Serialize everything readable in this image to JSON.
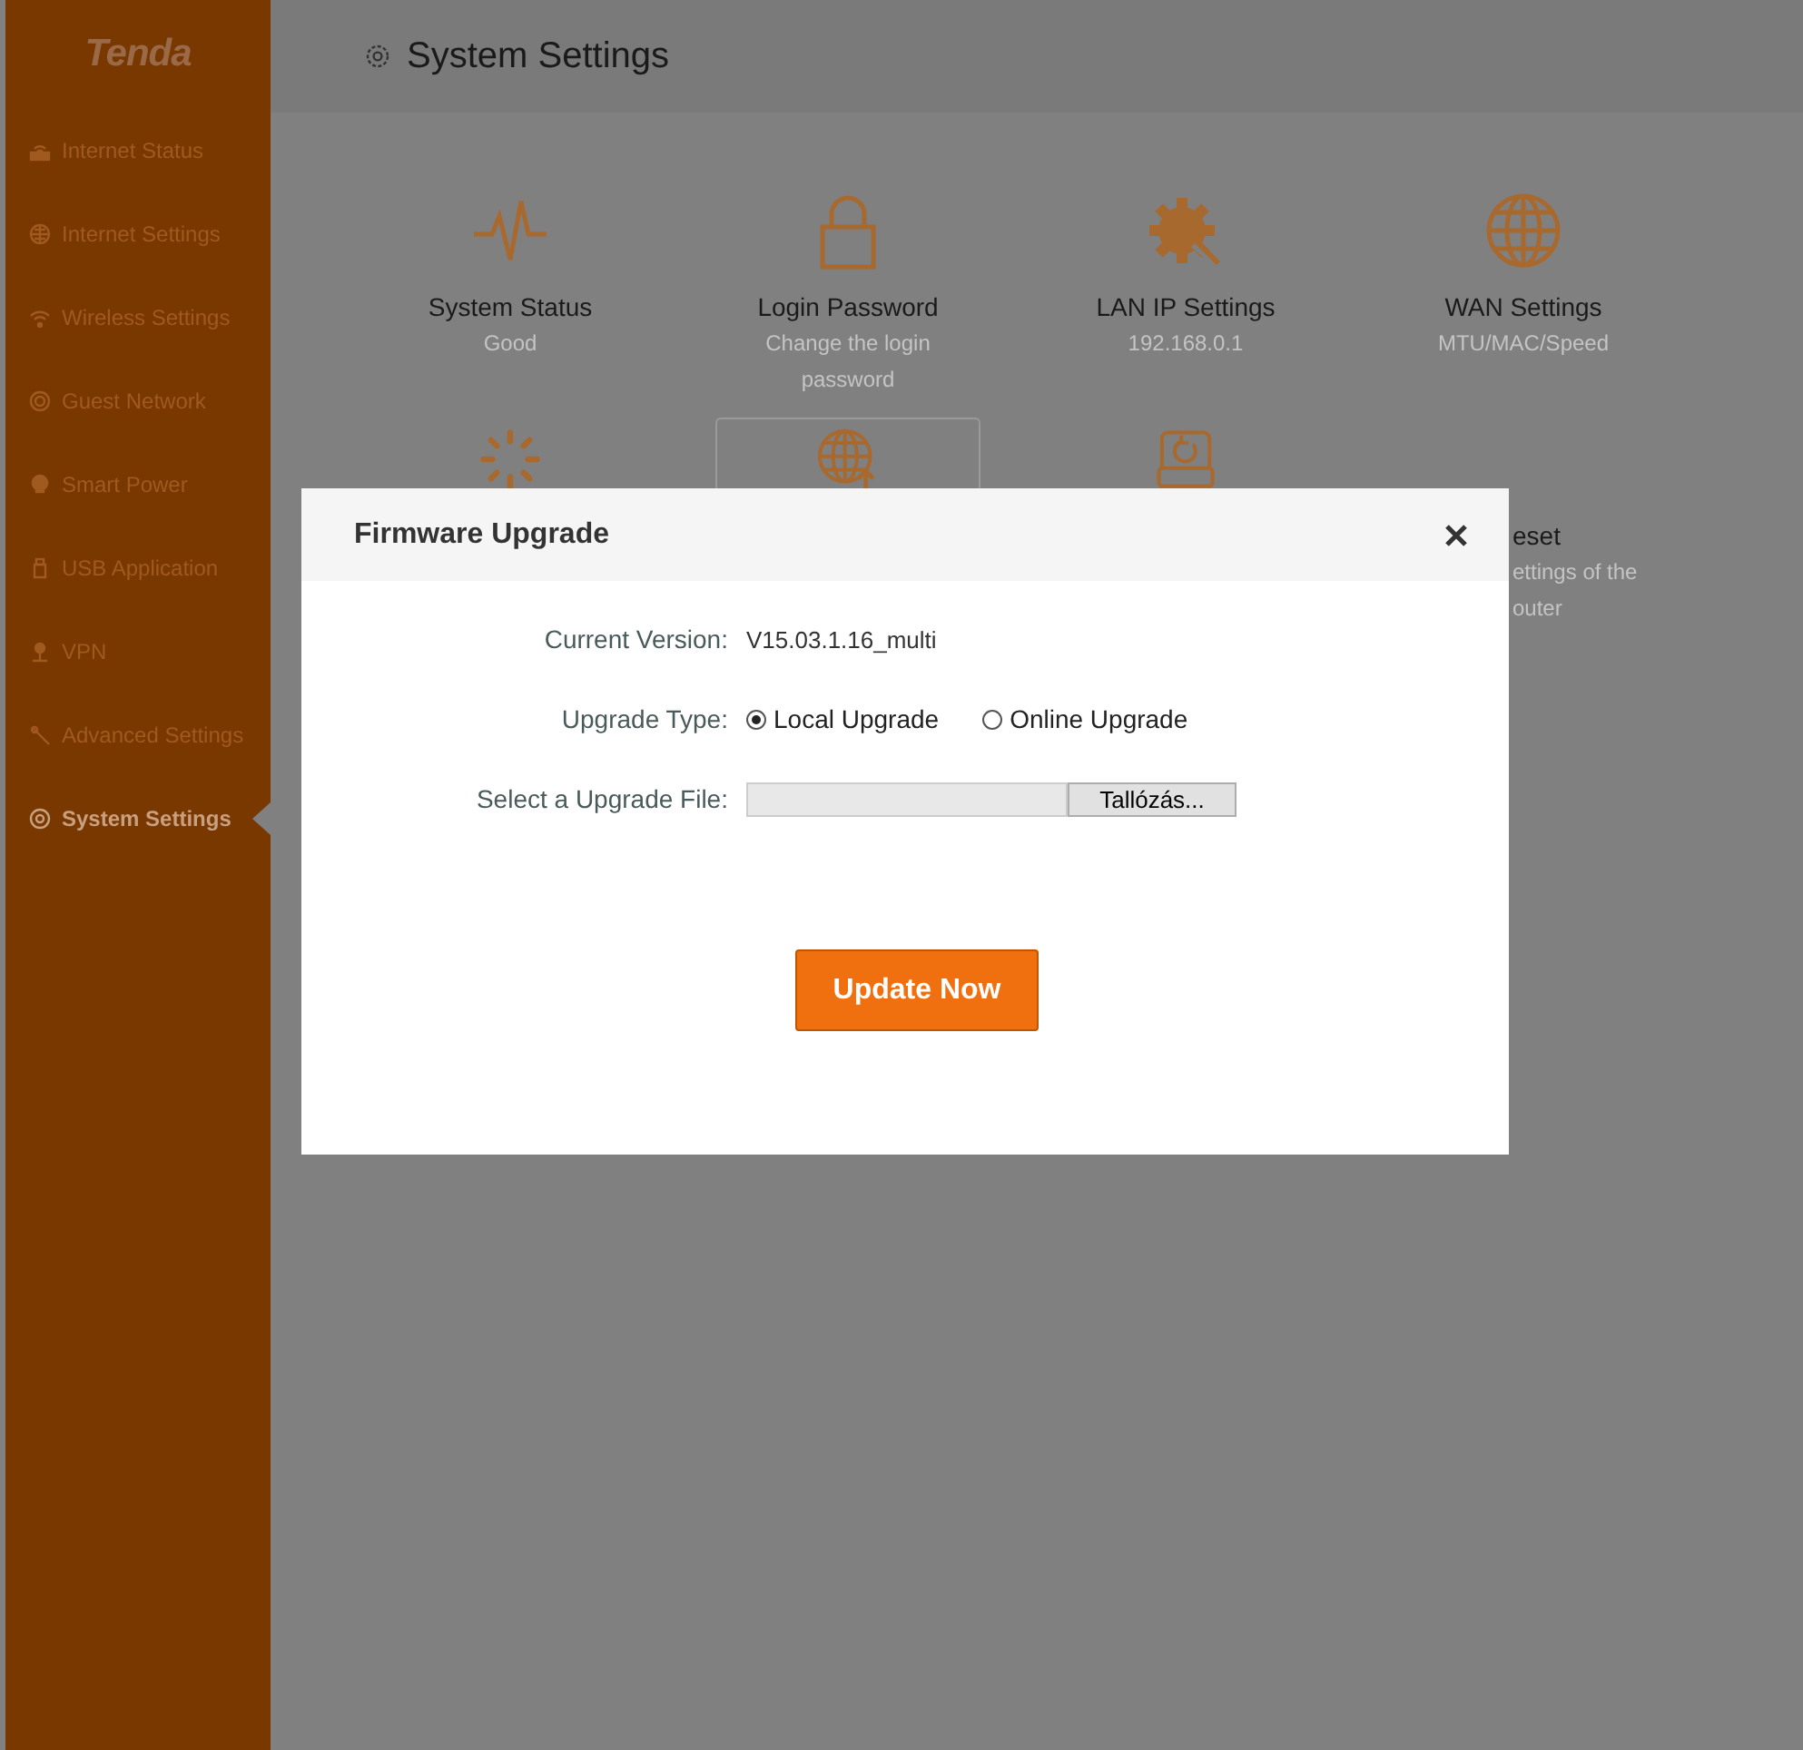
{
  "logo": "Tenda",
  "sidebar": {
    "items": [
      {
        "label": "Internet Status",
        "selected": false
      },
      {
        "label": "Internet Settings",
        "selected": false
      },
      {
        "label": "Wireless Settings",
        "selected": false
      },
      {
        "label": "Guest Network",
        "selected": false
      },
      {
        "label": "Smart Power",
        "selected": false
      },
      {
        "label": "USB Application",
        "selected": false
      },
      {
        "label": "VPN",
        "selected": false
      },
      {
        "label": "Advanced Settings",
        "selected": false
      },
      {
        "label": "System Settings",
        "selected": true
      }
    ]
  },
  "header": {
    "title": "System Settings"
  },
  "tiles": [
    {
      "name": "System Status",
      "detail": "Good",
      "selected": false
    },
    {
      "name": "Login Password",
      "detail": "Change the login password",
      "selected": false
    },
    {
      "name": "LAN IP Settings",
      "detail": "192.168.0.1",
      "selected": false
    },
    {
      "name": "WAN Settings",
      "detail": "MTU/MAC/Speed",
      "selected": false
    },
    {
      "selected": false
    },
    {
      "selected": true
    },
    {
      "selected": false
    },
    {
      "name": "eset",
      "detail": "ettings of the\nouter",
      "selected": false
    }
  ],
  "modal": {
    "title": "Firmware Upgrade",
    "fields": [
      {
        "kind": "text",
        "label": "Current Version:",
        "value": "V15.03.1.16_multi"
      },
      {
        "kind": "radio",
        "label": "Upgrade Type:",
        "options": [
          {
            "label": "Local Upgrade",
            "selected": true
          },
          {
            "label": "Online Upgrade",
            "selected": false
          }
        ]
      },
      {
        "kind": "file",
        "label": "Select a Upgrade File:",
        "button": "Tallózás..."
      }
    ],
    "primary_button": "Update Now"
  }
}
